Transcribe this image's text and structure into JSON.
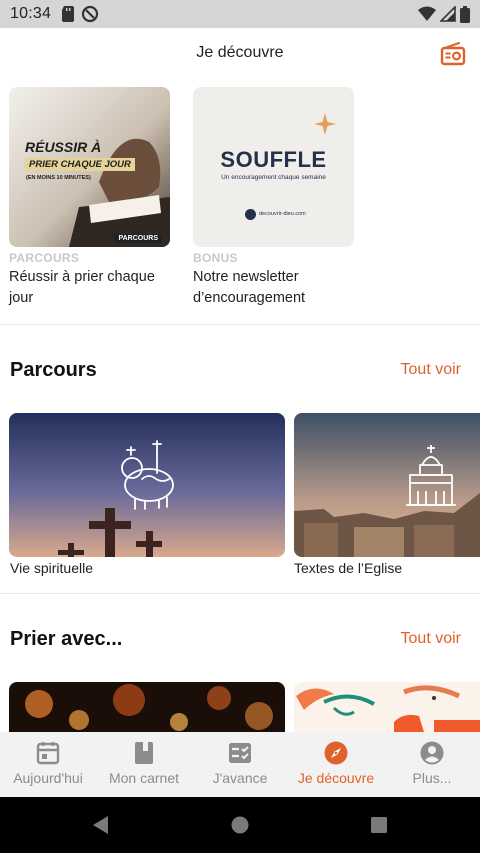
{
  "status": {
    "time": "10:34"
  },
  "header": {
    "title": "Je découvre"
  },
  "featured": [
    {
      "kicker": "PARCOURS",
      "title": "Réussir à prier chaque jour",
      "image": {
        "line1": "RÉUSSIR À",
        "line2": "PRIER CHAQUE JOUR",
        "line3": "(EN MOINS 10 MINUTES)",
        "tag": "PARCOURS"
      }
    },
    {
      "kicker": "BONUS",
      "title": "Notre newsletter d’encouragement",
      "image": {
        "line1": "SOUFFLE",
        "line2": "Un encouragement chaque semaine",
        "line3": "decouvrir-dieu.com"
      }
    }
  ],
  "sections": {
    "parcours": {
      "title": "Parcours",
      "see_all": "Tout voir",
      "items": [
        {
          "label": "Vie spirituelle"
        },
        {
          "label": "Textes de l’Eglise"
        }
      ]
    },
    "prier": {
      "title": "Prier avec...",
      "see_all": "Tout voir"
    }
  },
  "nav": [
    {
      "label": "Aujourd'hui",
      "icon": "calendar-icon",
      "active": false
    },
    {
      "label": "Mon carnet",
      "icon": "notebook-icon",
      "active": false
    },
    {
      "label": "J'avance",
      "icon": "checklist-icon",
      "active": false
    },
    {
      "label": "Je découvre",
      "icon": "compass-icon",
      "active": true
    },
    {
      "label": "Plus...",
      "icon": "account-icon",
      "active": false
    }
  ],
  "colors": {
    "accent": "#e0622b",
    "muted": "#8c8c8c"
  }
}
